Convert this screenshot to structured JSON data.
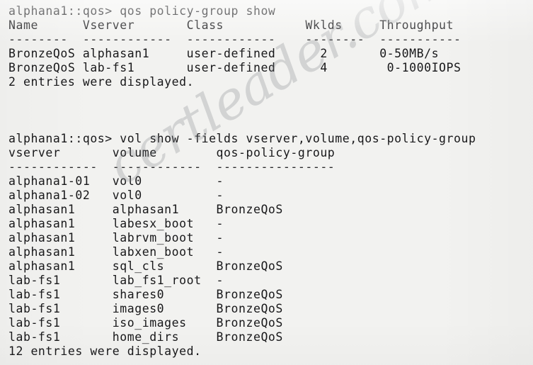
{
  "terminal": {
    "font": "monospace",
    "background_color": "#f2f2f0",
    "text_color": "#18181a",
    "prompt": "alphana1::qos>",
    "watermark": "certleader.com",
    "watermark_color": "#787a7e"
  },
  "sessions": [
    {
      "id": "qos-policy-group-show",
      "command_line": "alphana1::qos> qos policy-group show",
      "command": "qos policy-group show",
      "table": {
        "headers": [
          "Name",
          "Vserver",
          "Class",
          "Wklds",
          "Throughput"
        ],
        "separators": [
          "--------",
          "------------",
          "------------",
          "--------",
          "-----------"
        ],
        "rows": [
          [
            "BronzeQoS",
            "alphasan1",
            "user-defined",
            "2",
            "0-50MB/s"
          ],
          [
            "BronzeQoS",
            "lab-fs1",
            "user-defined",
            "4",
            "0-1000IOPS"
          ]
        ]
      },
      "footer": "2 entries were displayed."
    },
    {
      "id": "vol-show-fields",
      "command_line": "alphana1::qos> vol show -fields vserver,volume,qos-policy-group",
      "command": "vol show -fields vserver,volume,qos-policy-group",
      "table": {
        "headers": [
          "vserver",
          "volume",
          "qos-policy-group"
        ],
        "separators": [
          "------------",
          "------------",
          "----------------"
        ],
        "rows": [
          [
            "alphana1-01",
            "vol0",
            "-"
          ],
          [
            "alphana1-02",
            "vol0",
            "-"
          ],
          [
            "alphasan1",
            "alphasan1",
            "BronzeQoS"
          ],
          [
            "alphasan1",
            "labesx_boot",
            "-"
          ],
          [
            "alphasan1",
            "labrvm_boot",
            "-"
          ],
          [
            "alphasan1",
            "labxen_boot",
            "-"
          ],
          [
            "alphasan1",
            "sql_cls",
            "BronzeQoS"
          ],
          [
            "lab-fs1",
            "lab_fs1_root",
            "-"
          ],
          [
            "lab-fs1",
            "shares0",
            "BronzeQoS"
          ],
          [
            "lab-fs1",
            "images0",
            "BronzeQoS"
          ],
          [
            "lab-fs1",
            "iso_images",
            "BronzeQoS"
          ],
          [
            "lab-fs1",
            "home_dirs",
            "BronzeQoS"
          ]
        ]
      },
      "footer": "12 entries were displayed."
    }
  ],
  "rendered_lines": [
    "alphana1::qos> qos policy-group show",
    "Name      Vserver       Class           Wklds     Throughput",
    "--------  ------------  ------------    --------  -----------",
    "BronzeQoS alphasan1     user-defined      2       0-50MB/s",
    "BronzeQoS lab-fs1       user-defined      4        0-1000IOPS",
    "2 entries were displayed.",
    "",
    "",
    "",
    "alphana1::qos> vol show -fields vserver,volume,qos-policy-group",
    "vserver       volume        qos-policy-group",
    "------------  ------------  ----------------",
    "alphana1-01   vol0          -",
    "alphana1-02   vol0          -",
    "alphasan1     alphasan1     BronzeQoS",
    "alphasan1     labesx_boot   -",
    "alphasan1     labrvm_boot   -",
    "alphasan1     labxen_boot   -",
    "alphasan1     sql_cls       BronzeQoS",
    "lab-fs1       lab_fs1_root  -",
    "lab-fs1       shares0       BronzeQoS",
    "lab-fs1       images0       BronzeQoS",
    "lab-fs1       iso_images    BronzeQoS",
    "lab-fs1       home_dirs     BronzeQoS",
    "12 entries were displayed."
  ]
}
